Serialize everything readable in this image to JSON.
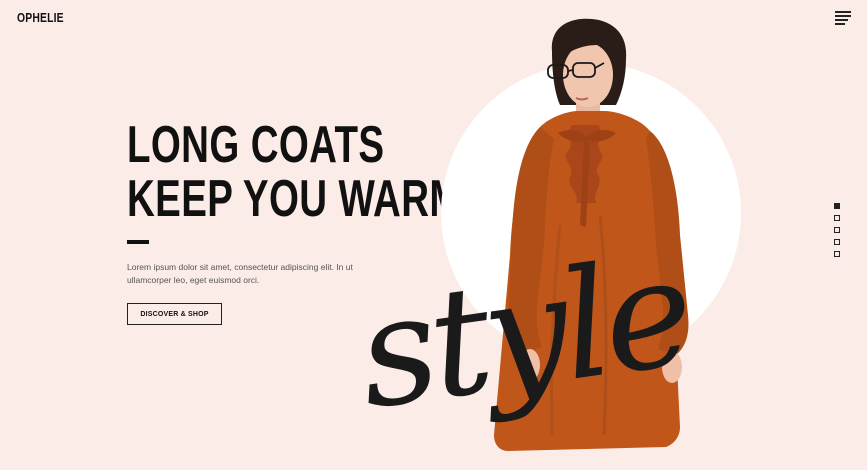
{
  "brand": {
    "logo_text": "OPHELIE"
  },
  "header": {
    "menu_icon": "hamburger-menu-icon"
  },
  "hero": {
    "headline_line1": "LONG COATS",
    "headline_line2": "KEEP YOU WARM",
    "description_line1": "Lorem ipsum dolor sit amet, consectetur adipiscing elit. In ut",
    "description_line2": "ullamcorper leo, eget euismod orci.",
    "cta_label": "DISCOVER & SHOP",
    "script_word": "style"
  },
  "slider": {
    "count": 5,
    "active_index": 0
  },
  "colors": {
    "background": "#fcece7",
    "circle": "#ffffff",
    "dress": "#c0561a",
    "text": "#111111"
  }
}
